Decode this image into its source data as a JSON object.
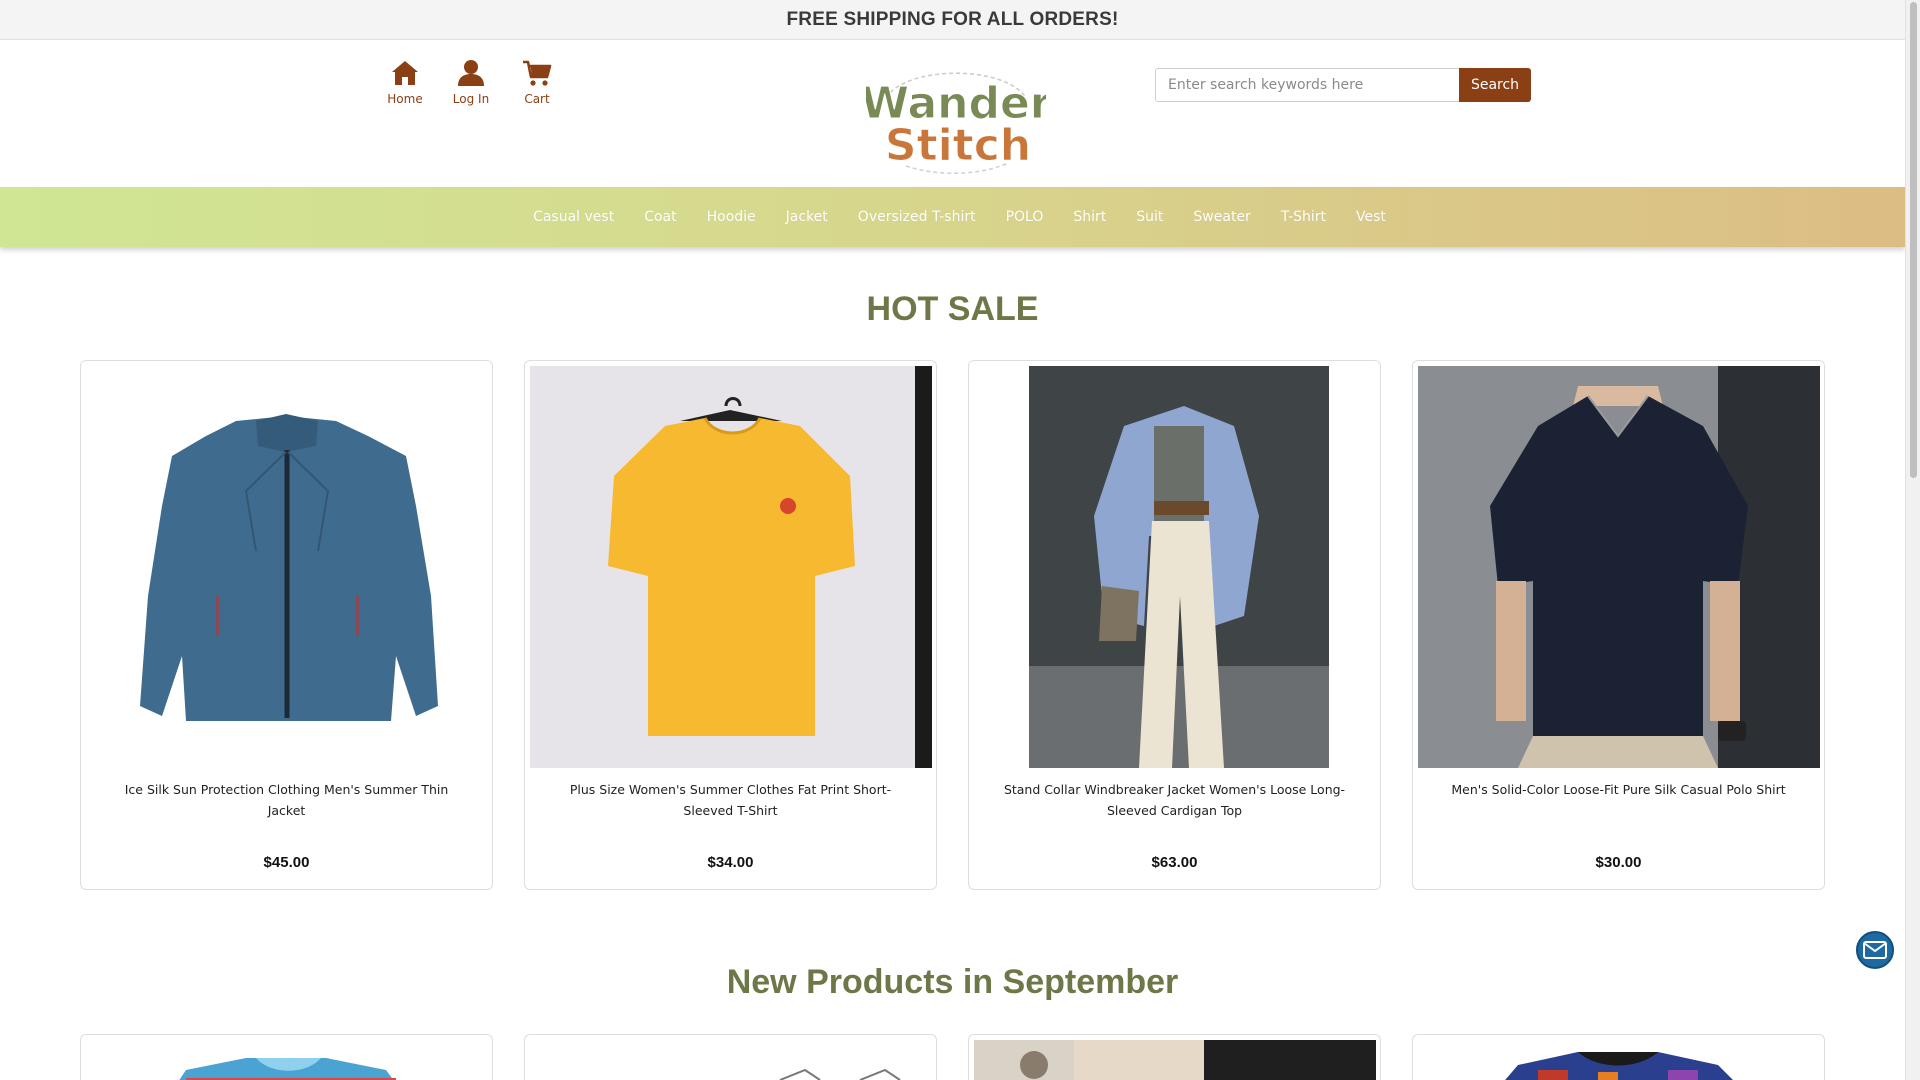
{
  "announcement": "FREE SHIPPING FOR ALL ORDERS!",
  "quicknav": [
    {
      "label": "Home",
      "icon": "home-icon"
    },
    {
      "label": "Log In",
      "icon": "user-icon"
    },
    {
      "label": "Cart",
      "icon": "cart-icon"
    }
  ],
  "logo": {
    "line1": "Wander",
    "line2": "Stitch"
  },
  "search": {
    "placeholder": "Enter search keywords here",
    "value": "",
    "button": "Search"
  },
  "categories": [
    "Casual vest",
    "Coat",
    "Hoodie",
    "Jacket",
    "Oversized T-shirt",
    "POLO",
    "Shirt",
    "Suit",
    "Sweater",
    "T-Shirt",
    "Vest"
  ],
  "hot_sale": {
    "title": "HOT SALE",
    "products": [
      {
        "name": "Ice Silk Sun Protection Clothing Men's Summer Thin Jacket",
        "price": "$45.00"
      },
      {
        "name": "Plus Size Women's Summer Clothes Fat Print Short-Sleeved T-Shirt",
        "price": "$34.00"
      },
      {
        "name": "Stand Collar Windbreaker Jacket Women's Loose Long-Sleeved Cardigan Top",
        "price": "$63.00"
      },
      {
        "name": "Men's Solid-Color Loose-Fit Pure Silk Casual Polo Shirt",
        "price": "$30.00"
      }
    ]
  },
  "new_products": {
    "title": "New Products in September"
  },
  "colors": {
    "accent": "#8a3f14",
    "section_title": "#6d7747",
    "catbar_left": "#cfe694",
    "catbar_right": "#dcbd84",
    "mail_button": "#1e6aa0"
  }
}
